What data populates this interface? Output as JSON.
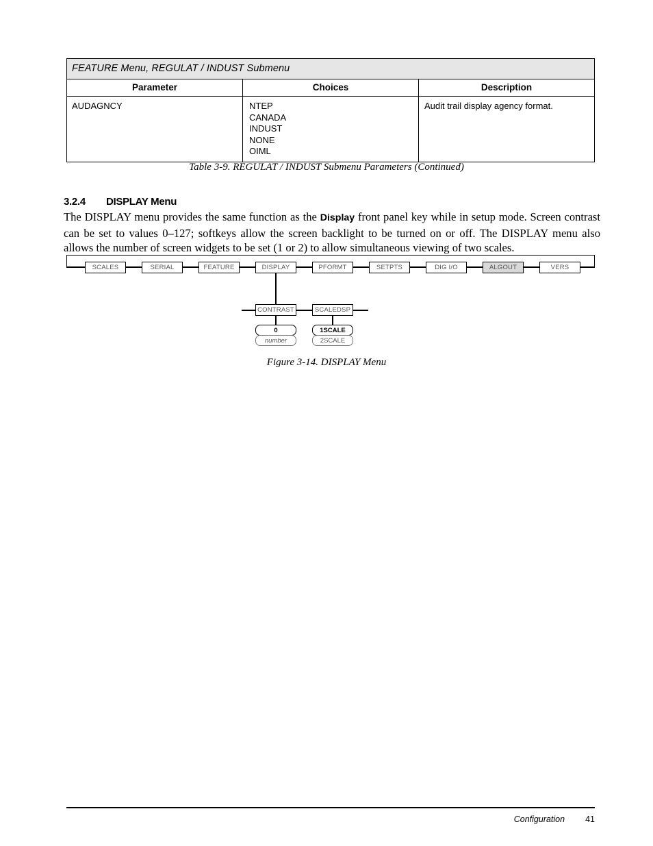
{
  "table": {
    "title": "FEATURE Menu, REGULAT / INDUST Submenu",
    "headers": [
      "Parameter",
      "Choices",
      "Description"
    ],
    "rows": [
      {
        "parameter": "AUDAGNCY",
        "choices": [
          "NTEP",
          "CANADA",
          "INDUST",
          "NONE",
          "OIML"
        ],
        "description": "Audit trail display agency format."
      }
    ],
    "caption": "Table 3-9. REGULAT / INDUST Submenu Parameters (Continued)"
  },
  "section": {
    "number": "3.2.4",
    "title": "DISPLAY Menu",
    "paragraph_part1": "The DISPLAY menu provides the same function as the ",
    "paragraph_bold": "Display",
    "paragraph_part2": " front panel key while in setup mode. Screen contrast can be set to values 0–127; softkeys allow the screen backlight to be turned on or off. The DISPLAY menu also allows the number of screen widgets to be set (1 or 2) to allow simultaneous viewing of two scales."
  },
  "figure": {
    "caption": "Figure 3-14. DISPLAY Menu",
    "top_menu": [
      {
        "label": "SCALES",
        "shaded": false
      },
      {
        "label": "SERIAL",
        "shaded": false
      },
      {
        "label": "FEATURE",
        "shaded": false
      },
      {
        "label": "DISPLAY",
        "shaded": false
      },
      {
        "label": "PFORMT",
        "shaded": false
      },
      {
        "label": "SETPTS",
        "shaded": false
      },
      {
        "label": "DIG I/O",
        "shaded": false
      },
      {
        "label": "ALGOUT",
        "shaded": true
      },
      {
        "label": "VERS",
        "shaded": false
      }
    ],
    "submenu": [
      {
        "label": "CONTRAST"
      },
      {
        "label": "SCALEDSP"
      }
    ],
    "values": {
      "contrast": [
        {
          "label": "0",
          "style": "strong"
        },
        {
          "label": "number",
          "style": "italic"
        }
      ],
      "scaledsp": [
        {
          "label": "1SCALE",
          "style": "strong"
        },
        {
          "label": "2SCALE",
          "style": "normal"
        }
      ]
    }
  },
  "footer": {
    "label": "Configuration",
    "page": "41"
  }
}
